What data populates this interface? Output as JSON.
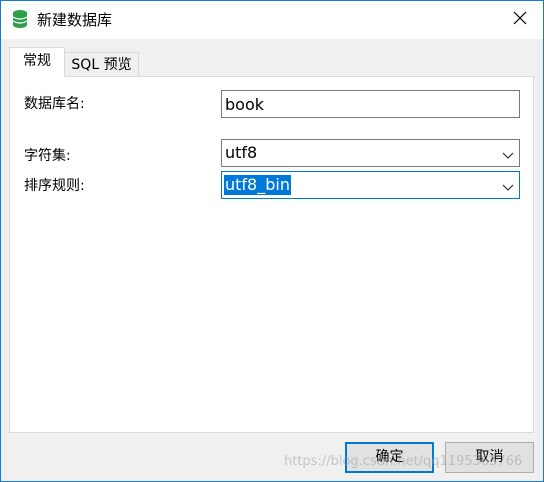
{
  "window": {
    "title": "新建数据库",
    "icon": "database-icon",
    "close_icon": "close-icon"
  },
  "tabs": [
    {
      "label": "常规",
      "active": true
    },
    {
      "label": "SQL 预览",
      "active": false
    }
  ],
  "form": {
    "db_name": {
      "label": "数据库名:",
      "value": "book"
    },
    "charset": {
      "label": "字符集:",
      "value": "utf8"
    },
    "collation": {
      "label": "排序规则:",
      "value": "utf8_bin"
    }
  },
  "buttons": {
    "ok_label": "确定",
    "cancel_label": "取消"
  },
  "watermark": "https://blog.csdn.net/qq1195365766",
  "colors": {
    "accent": "#0078d7",
    "icon_green": "#2e9e4a"
  }
}
